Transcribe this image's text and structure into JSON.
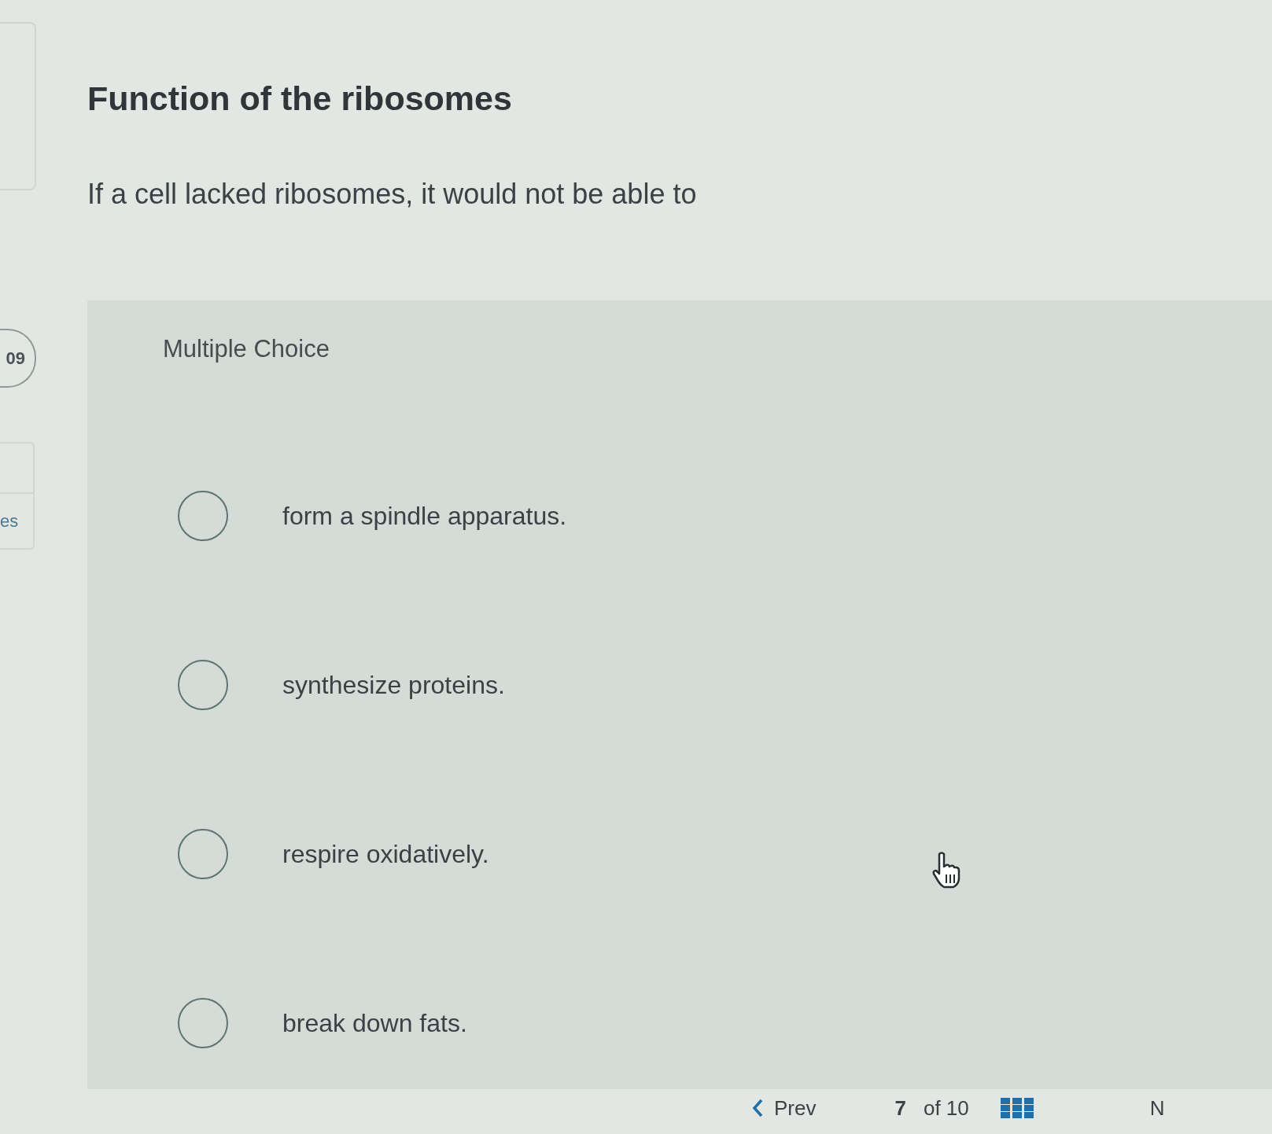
{
  "sidebar": {
    "question_badge": "09",
    "item_label": "es"
  },
  "question": {
    "title": "Function of the ribosomes",
    "prompt": "If a cell lacked ribosomes, it would not be able to"
  },
  "answer_panel": {
    "type_label": "Multiple Choice",
    "options": [
      {
        "text": "form a spindle apparatus.",
        "selected": false
      },
      {
        "text": "synthesize proteins.",
        "selected": false
      },
      {
        "text": "respire oxidatively.",
        "selected": false
      },
      {
        "text": "break down fats.",
        "selected": false
      }
    ]
  },
  "pagination": {
    "prev_label": "Prev",
    "current": "7",
    "total": "of 10",
    "next_label": "N"
  }
}
